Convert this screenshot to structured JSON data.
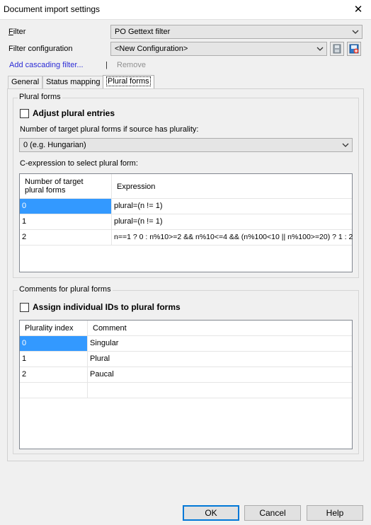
{
  "window": {
    "title": "Document import settings"
  },
  "filter": {
    "label": "Filter",
    "value": "PO Gettext filter",
    "config_label": "Filter configuration",
    "config_value": "<New Configuration>"
  },
  "links": {
    "add_cascading": "Add cascading filter...",
    "separator": "|",
    "remove": "Remove"
  },
  "tabs": [
    {
      "label": "General"
    },
    {
      "label": "Status mapping"
    },
    {
      "label": "Plural forms"
    }
  ],
  "plural": {
    "group_title": "Plural forms",
    "adjust_label": "Adjust plural entries",
    "adjust_checked": false,
    "number_label": "Number of target plural forms if source has plurality:",
    "number_value": "0 (e.g. Hungarian)",
    "cexpr_label": "C-expression to select plural form:",
    "columns": [
      "Number of target plural forms",
      "Expression"
    ],
    "col0_line1": "Number of target",
    "col0_line2": "plural forms",
    "rows": [
      {
        "n": "0",
        "expr": "plural=(n != 1)"
      },
      {
        "n": "1",
        "expr": "plural=(n != 1)"
      },
      {
        "n": "2",
        "expr": "n==1 ? 0 : n%10>=2 && n%10<=4 && (n%100<10 || n%100>=20) ? 1 : 2"
      }
    ]
  },
  "comments": {
    "group_title": "Comments for plural forms",
    "assign_label": "Assign individual IDs to plural forms",
    "assign_checked": false,
    "columns": [
      "Plurality index",
      "Comment"
    ],
    "rows": [
      {
        "index": "0",
        "comment": "Singular"
      },
      {
        "index": "1",
        "comment": "Plural"
      },
      {
        "index": "2",
        "comment": "Paucal"
      }
    ]
  },
  "buttons": {
    "ok": "OK",
    "cancel": "Cancel",
    "help": "Help"
  },
  "colors": {
    "selection": "#3399ff",
    "link": "#2b2bd6",
    "default_button_border": "#0078d7"
  }
}
